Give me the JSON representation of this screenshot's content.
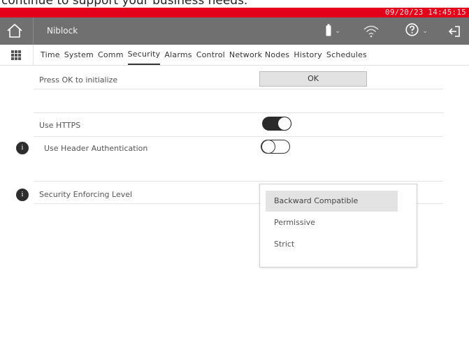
{
  "caption": "continue to support your business needs.",
  "statusbar": {
    "datetime": "09/20/23 14:45:15",
    "color": "#e3001b"
  },
  "header": {
    "title": "Niblock",
    "icons": [
      "home-icon",
      "battery-icon",
      "wifi-icon",
      "help-icon",
      "logout-icon"
    ],
    "background": "#707070"
  },
  "tabs": [
    {
      "label": "Time"
    },
    {
      "label": "System"
    },
    {
      "label": "Comm"
    },
    {
      "label": "Security",
      "active": true
    },
    {
      "label": "Alarms"
    },
    {
      "label": "Control"
    },
    {
      "label": "Network Nodes"
    },
    {
      "label": "History"
    },
    {
      "label": "Schedules"
    }
  ],
  "security": {
    "init_label": "Press OK to initialize",
    "ok_label": "OK",
    "https_label": "Use HTTPS",
    "https_on": true,
    "header_auth_label": "Use Header Authentication",
    "header_auth_on": false,
    "info_glyph": "i",
    "enforcing_label": "Security Enforcing Level",
    "enforcing_options": [
      "Backward Compatible",
      "Permissive",
      "Strict"
    ],
    "enforcing_selected": "Backward Compatible"
  }
}
